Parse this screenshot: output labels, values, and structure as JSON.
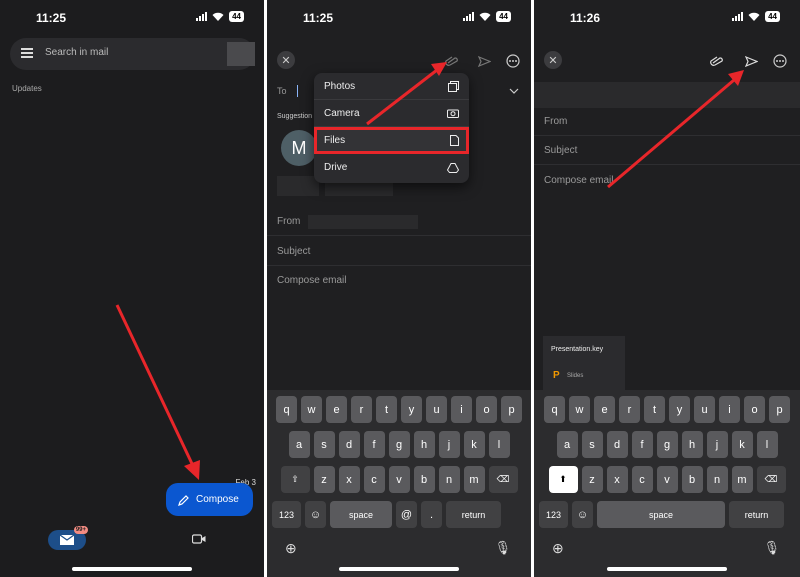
{
  "panels": [
    {
      "status_time": "11:25",
      "battery": "44",
      "search_placeholder": "Search in mail",
      "section_label": "Updates",
      "date_label": "Feb 3",
      "compose_label": "Compose",
      "mail_badge": "99+"
    },
    {
      "status_time": "11:25",
      "battery": "44",
      "to_label": "To",
      "suggestions_label": "Suggestion",
      "avatar_letter": "M",
      "menu_items": [
        "Photos",
        "Camera",
        "Files",
        "Drive"
      ],
      "from_label": "From",
      "subject_label": "Subject",
      "compose_placeholder": "Compose email"
    },
    {
      "status_time": "11:26",
      "battery": "44",
      "from_label": "From",
      "subject_label": "Subject",
      "compose_placeholder": "Compose email",
      "attachment_name": "Presentation.key",
      "attachment_app": "Slides"
    }
  ],
  "keyboard": {
    "row1": [
      "q",
      "w",
      "e",
      "r",
      "t",
      "y",
      "u",
      "i",
      "o",
      "p"
    ],
    "row2": [
      "a",
      "s",
      "d",
      "f",
      "g",
      "h",
      "j",
      "k",
      "l"
    ],
    "row3": [
      "z",
      "x",
      "c",
      "v",
      "b",
      "n",
      "m"
    ],
    "num_key": "123",
    "space_key": "space",
    "at_key": "@",
    "dot_key": ".",
    "return_key": "return"
  },
  "colors": {
    "accent_blue": "#0b57d0",
    "highlight_red": "#e8262a",
    "background_dark": "#1f1f21"
  }
}
